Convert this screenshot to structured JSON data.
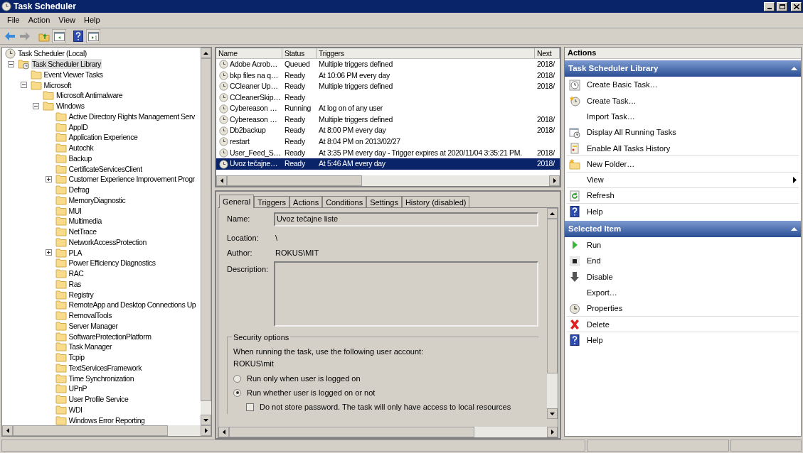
{
  "window": {
    "title": "Task Scheduler"
  },
  "menu": [
    "File",
    "Action",
    "View",
    "Help"
  ],
  "toolbar": [
    {
      "kind": "back",
      "disabled": false
    },
    {
      "kind": "forward",
      "disabled": true
    },
    {
      "kind": "up"
    },
    {
      "kind": "tree"
    },
    {
      "kind": "help"
    },
    {
      "kind": "pane"
    }
  ],
  "tree": [
    {
      "label": "Task Scheduler (Local)",
      "kind": "clock",
      "selected": false,
      "children": [
        {
          "label": "Task Scheduler Library",
          "kind": "library",
          "selected": true,
          "expanded": true,
          "children": [
            {
              "label": "Event Viewer Tasks",
              "kind": "folder",
              "selected": false
            },
            {
              "label": "Microsoft",
              "kind": "folder",
              "selected": false,
              "expanded": true,
              "children": [
                {
                  "label": "Microsoft Antimalware",
                  "kind": "folder",
                  "selected": false
                },
                {
                  "label": "Windows",
                  "kind": "folder",
                  "selected": false,
                  "expanded": true,
                  "children": [
                    {
                      "label": "Active Directory Rights Management Serv",
                      "kind": "folder",
                      "selected": false
                    },
                    {
                      "label": "AppID",
                      "kind": "folder",
                      "selected": false
                    },
                    {
                      "label": "Application Experience",
                      "kind": "folder",
                      "selected": false
                    },
                    {
                      "label": "Autochk",
                      "kind": "folder",
                      "selected": false
                    },
                    {
                      "label": "Backup",
                      "kind": "folder",
                      "selected": false
                    },
                    {
                      "label": "CertificateServicesClient",
                      "kind": "folder",
                      "selected": false
                    },
                    {
                      "label": "Customer Experience Improvement Progr",
                      "kind": "folder",
                      "selected": false,
                      "expanded": false
                    },
                    {
                      "label": "Defrag",
                      "kind": "folder",
                      "selected": false
                    },
                    {
                      "label": "MemoryDiagnostic",
                      "kind": "folder",
                      "selected": false
                    },
                    {
                      "label": "MUI",
                      "kind": "folder",
                      "selected": false
                    },
                    {
                      "label": "Multimedia",
                      "kind": "folder",
                      "selected": false
                    },
                    {
                      "label": "NetTrace",
                      "kind": "folder",
                      "selected": false
                    },
                    {
                      "label": "NetworkAccessProtection",
                      "kind": "folder",
                      "selected": false
                    },
                    {
                      "label": "PLA",
                      "kind": "folder",
                      "selected": false,
                      "expanded": false
                    },
                    {
                      "label": "Power Efficiency Diagnostics",
                      "kind": "folder",
                      "selected": false
                    },
                    {
                      "label": "RAC",
                      "kind": "folder",
                      "selected": false
                    },
                    {
                      "label": "Ras",
                      "kind": "folder",
                      "selected": false
                    },
                    {
                      "label": "Registry",
                      "kind": "folder",
                      "selected": false
                    },
                    {
                      "label": "RemoteApp and Desktop Connections Up",
                      "kind": "folder",
                      "selected": false
                    },
                    {
                      "label": "RemovalTools",
                      "kind": "folder",
                      "selected": false
                    },
                    {
                      "label": "Server Manager",
                      "kind": "folder",
                      "selected": false
                    },
                    {
                      "label": "SoftwareProtectionPlatform",
                      "kind": "folder",
                      "selected": false
                    },
                    {
                      "label": "Task Manager",
                      "kind": "folder",
                      "selected": false
                    },
                    {
                      "label": "Tcpip",
                      "kind": "folder",
                      "selected": false
                    },
                    {
                      "label": "TextServicesFramework",
                      "kind": "folder",
                      "selected": false
                    },
                    {
                      "label": "Time Synchronization",
                      "kind": "folder",
                      "selected": false
                    },
                    {
                      "label": "UPnP",
                      "kind": "folder",
                      "selected": false
                    },
                    {
                      "label": "User Profile Service",
                      "kind": "folder",
                      "selected": false
                    },
                    {
                      "label": "WDI",
                      "kind": "folder",
                      "selected": false
                    },
                    {
                      "label": "Windows Error Reporting",
                      "kind": "folder",
                      "selected": false
                    }
                  ]
                }
              ]
            }
          ]
        }
      ]
    }
  ],
  "table": {
    "columns": [
      "Name",
      "Status",
      "Triggers",
      "Next"
    ],
    "rows": [
      {
        "name": "Adobe Acrob…",
        "status": "Queued",
        "triggers": "Multiple triggers defined",
        "column_4": "2018/",
        "selected": false
      },
      {
        "name": "bkp files na q…",
        "status": "Ready",
        "triggers": "At 10:06 PM every day",
        "column_4": "2018/",
        "selected": false
      },
      {
        "name": "CCleaner Up…",
        "status": "Ready",
        "triggers": "Multiple triggers defined",
        "column_4": "2018/",
        "selected": false
      },
      {
        "name": "CCleanerSkip…",
        "status": "Ready",
        "triggers": "",
        "column_4": "",
        "selected": false
      },
      {
        "name": "Cybereason …",
        "status": "Running",
        "triggers": "At log on of any user",
        "column_4": "",
        "selected": false
      },
      {
        "name": "Cybereason …",
        "status": "Ready",
        "triggers": "Multiple triggers defined",
        "column_4": "2018/",
        "selected": false
      },
      {
        "name": "Db2backup",
        "status": "Ready",
        "triggers": "At 8:00 PM every day",
        "column_4": "2018/",
        "selected": false
      },
      {
        "name": "restart",
        "status": "Ready",
        "triggers": "At 8:04 PM on 2013/02/27",
        "column_4": "",
        "selected": false
      },
      {
        "name": "User_Feed_S…",
        "status": "Ready",
        "triggers": "At 3:35 PM every day - Trigger expires at 2020/11/04 3:35:21 PM.",
        "column_4": "2018/",
        "selected": false
      },
      {
        "name": "Uvoz tečajne…",
        "status": "Ready",
        "triggers": "At 5:46 AM every day",
        "column_4": "2018/",
        "selected": true
      }
    ]
  },
  "detail_tabs": [
    {
      "label": "General",
      "selected": true
    },
    {
      "label": "Triggers",
      "selected": false
    },
    {
      "label": "Actions",
      "selected": false
    },
    {
      "label": "Conditions",
      "selected": false
    },
    {
      "label": "Settings",
      "selected": false
    },
    {
      "label": "History (disabled)",
      "selected": false
    }
  ],
  "general": {
    "name_label": "Name:",
    "name_value": "Uvoz tečajne liste",
    "location_label": "Location:",
    "location_value": "\\",
    "author_label": "Author:",
    "author_value": "ROKUS\\MIT",
    "description_label": "Description:",
    "security": {
      "title": "Security options",
      "prompt": "When running the task, use the following user account:",
      "account": "ROKUS\\mit",
      "radios": [
        {
          "label": "Run only when user is logged on",
          "selected": false
        },
        {
          "label": "Run whether user is logged on or not",
          "selected": true
        }
      ],
      "checkbox": {
        "label": "Do not store password.  The task will only have access to local resources",
        "checked": false
      }
    }
  },
  "actions_pane": {
    "title": "Actions",
    "sections": [
      {
        "title": "Task Scheduler Library",
        "items": [
          {
            "label": "Create Basic Task…",
            "kind": "basic",
            "divider": false
          },
          {
            "label": "Create Task…",
            "kind": "create",
            "divider": false
          },
          {
            "label": "Import Task…",
            "kind": "plain",
            "divider": false
          },
          {
            "label": "Display All Running Tasks",
            "kind": "running",
            "divider": false
          },
          {
            "label": "Enable All Tasks History",
            "kind": "history",
            "divider": false
          },
          {
            "label": "New Folder…",
            "kind": "folder",
            "divider": true
          },
          {
            "label": "View",
            "kind": "submenu",
            "divider": true
          },
          {
            "label": "Refresh",
            "kind": "refresh",
            "divider": true
          },
          {
            "label": "Help",
            "kind": "help",
            "divider": true
          }
        ]
      },
      {
        "title": "Selected Item",
        "items": [
          {
            "label": "Run",
            "kind": "run",
            "divider": false
          },
          {
            "label": "End",
            "kind": "end",
            "divider": false
          },
          {
            "label": "Disable",
            "kind": "disable",
            "divider": false
          },
          {
            "label": "Export…",
            "kind": "plain",
            "divider": false
          },
          {
            "label": "Properties",
            "kind": "properties",
            "divider": false
          },
          {
            "label": "Delete",
            "kind": "delete",
            "divider": true
          },
          {
            "label": "Help",
            "kind": "help",
            "divider": true
          }
        ]
      }
    ]
  }
}
